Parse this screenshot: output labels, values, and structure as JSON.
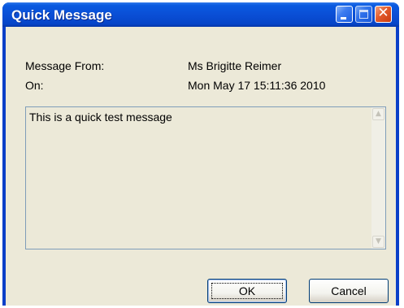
{
  "window": {
    "title": "Quick Message"
  },
  "fields": {
    "from_label": "Message From:",
    "from_value": "Ms Brigitte Reimer",
    "on_label": "On:",
    "on_value": "Mon May 17 15:11:36 2010"
  },
  "message": {
    "text": "This is a quick test message"
  },
  "buttons": {
    "ok_label": "OK",
    "cancel_label": "Cancel"
  },
  "icons": {
    "minimize": "minimize-icon",
    "maximize": "maximize-icon",
    "close": "close-icon",
    "scroll_up": "scroll-up-arrow-icon",
    "scroll_down": "scroll-down-arrow-icon"
  },
  "colors": {
    "titlebar": "#0a4fd6",
    "client_background": "#ece9d8",
    "close_button": "#e25a2b"
  }
}
